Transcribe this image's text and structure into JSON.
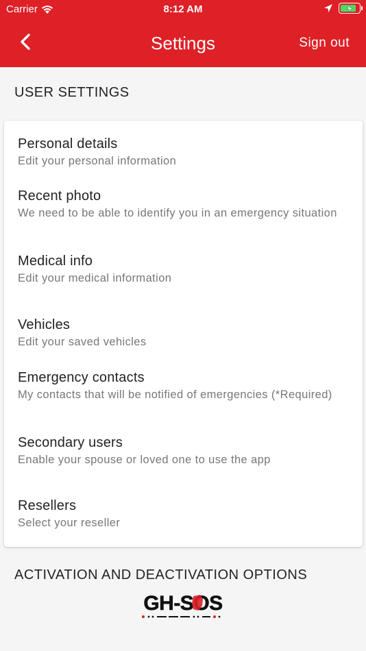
{
  "status_bar": {
    "carrier": "Carrier",
    "time": "8:12 AM",
    "icons": [
      "wifi-icon",
      "location-arrow-icon",
      "battery-charging-icon"
    ]
  },
  "header": {
    "title": "Settings",
    "back_icon": "chevron-left-icon",
    "sign_out_label": "Sign out",
    "background_color": "#de2027"
  },
  "user_settings": {
    "section_title": "USER SETTINGS",
    "items": [
      {
        "title": "Personal details",
        "subtitle": "Edit your personal information"
      },
      {
        "title": "Recent photo",
        "subtitle": "We need to be able to identify you in an emergency situation"
      },
      {
        "title": "Medical info",
        "subtitle": "Edit your medical information"
      },
      {
        "title": "Vehicles",
        "subtitle": "Edit your saved vehicles"
      },
      {
        "title": "Emergency contacts",
        "subtitle": "My contacts that will be notified of emergencies (*Required)"
      },
      {
        "title": "Secondary users",
        "subtitle": "Enable your spouse or loved one to use the app"
      },
      {
        "title": "Resellers",
        "subtitle": "Select your reseller"
      }
    ]
  },
  "activation": {
    "section_title": "ACTIVATION AND DEACTIVATION OPTIONS",
    "logo_text": "GH-SOS"
  }
}
